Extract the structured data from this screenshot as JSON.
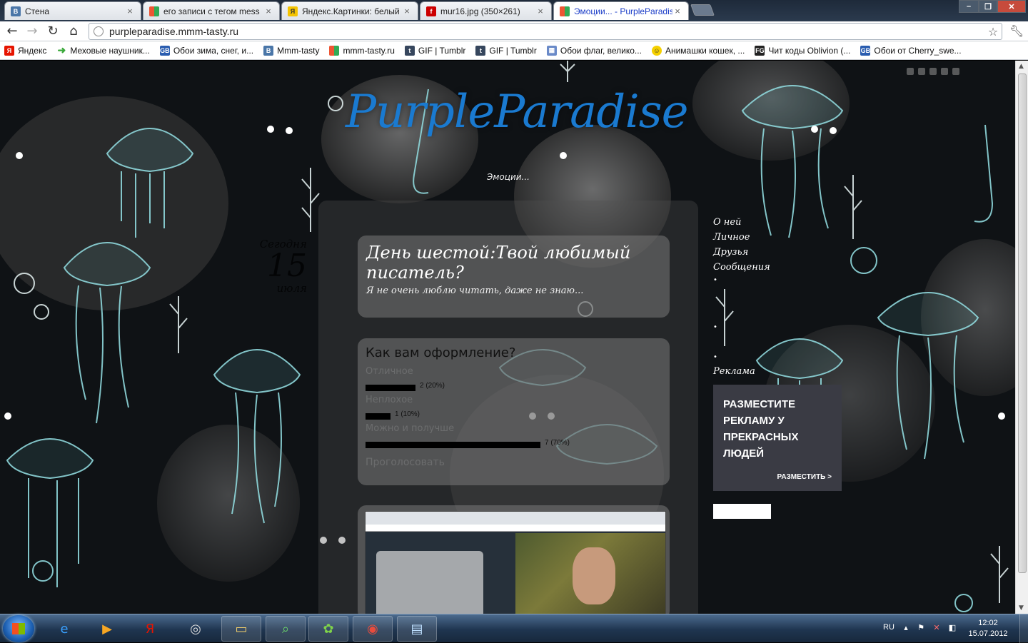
{
  "browser": {
    "tabs": [
      {
        "title": "Стена",
        "favicon": "vk",
        "favicon_color": "#4a76a8"
      },
      {
        "title": "его записи с тегом mess",
        "favicon": "mmm",
        "favicon_color": "#888888"
      },
      {
        "title": "Яндекс.Картинки: белый",
        "favicon": "yandex-images",
        "favicon_color": "#f5c400"
      },
      {
        "title": "mur16.jpg (350×261)",
        "favicon": "free",
        "favicon_color": "#cc0000"
      },
      {
        "title": "Эмоции... - PurpleParadise",
        "favicon": "mmm",
        "favicon_color": "#888888"
      }
    ],
    "address": "purpleparadise.mmm-tasty.ru",
    "bookmarks": [
      {
        "label": "Яндекс",
        "icon": "yandex",
        "color": "#e61400"
      },
      {
        "label": "Меховые наушник...",
        "icon": "arrow",
        "color": "#3aa93a"
      },
      {
        "label": "Обои зима, снег, и...",
        "icon": "gb",
        "color": "#2a5db0"
      },
      {
        "label": "Mmm-tasty",
        "icon": "vk",
        "color": "#4a76a8"
      },
      {
        "label": "mmm-tasty.ru",
        "icon": "mmm",
        "color": "#888888"
      },
      {
        "label": "GIF | Tumblr",
        "icon": "tumblr",
        "color": "#36465d"
      },
      {
        "label": "GIF | Tumblr",
        "icon": "tumblr",
        "color": "#36465d"
      },
      {
        "label": "Обои флаг, велико...",
        "icon": "wallpaper",
        "color": "#6a8ac8"
      },
      {
        "label": "Анимашки кошек, ...",
        "icon": "smiley",
        "color": "#f5d000"
      },
      {
        "label": "Чит коды Oblivion (...",
        "icon": "fg",
        "color": "#222222"
      },
      {
        "label": "Обои от Cherry_swe...",
        "icon": "gb",
        "color": "#2a5db0"
      }
    ]
  },
  "site": {
    "title": "PurpleParadise",
    "subtitle": "Эмоции...",
    "today_label": "Сегодня",
    "today_day": "15",
    "today_month": "июля"
  },
  "post": {
    "title": "День шестой:Твой любимый писатель?",
    "excerpt": "Я не очень люблю читать, даже не знаю..."
  },
  "poll": {
    "question": "Как вам оформление?",
    "options": [
      {
        "label": "Отличное",
        "count_text": "2 (20%)",
        "percent": 20
      },
      {
        "label": "Неплохое",
        "count_text": "1 (10%)",
        "percent": 10
      },
      {
        "label": "Можно и получше",
        "count_text": "7 (70%)",
        "percent": 70
      }
    ],
    "footer": "Проголосовать"
  },
  "sidebar": {
    "nav": [
      "О ней",
      "Личное",
      "Друзья",
      "Сообщения"
    ],
    "ad_label": "Реклама",
    "ad_text": "Разместите рекламу у прекрасных людей",
    "ad_link": "РАЗМЕСТИТЬ >"
  },
  "taskbar": {
    "language": "RU",
    "time": "12:02",
    "date": "15.07.2012",
    "apps": [
      "ie-icon",
      "media-player-icon",
      "yandex-icon",
      "cd-icon",
      "folder-icon",
      "magnifier-icon",
      "icq-icon",
      "chrome-icon",
      "notepad-icon"
    ]
  }
}
